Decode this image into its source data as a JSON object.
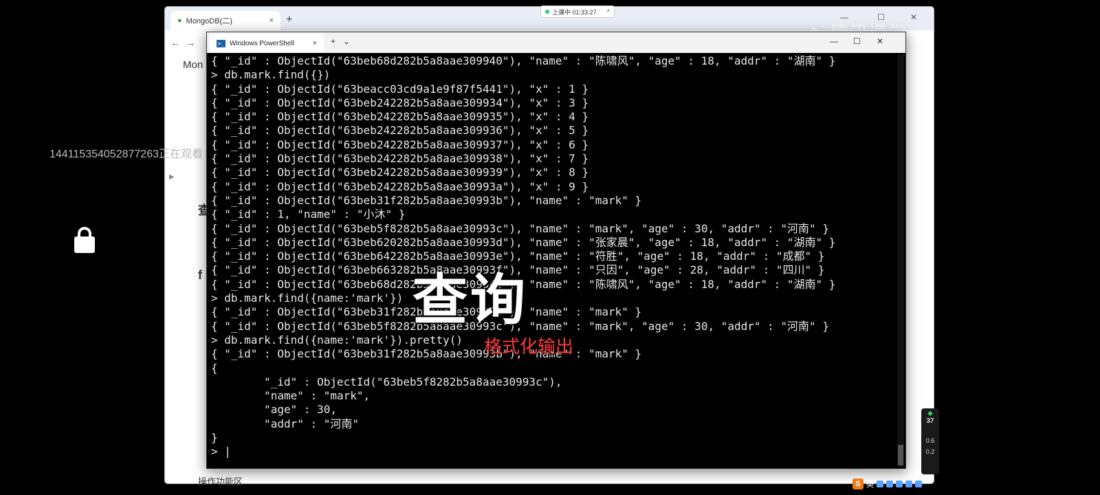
{
  "browser": {
    "tab_title": "MongoDB(二)",
    "tab_close": "×",
    "new_tab": "+",
    "nav_back": "←",
    "nav_forward": "→",
    "win_min": "—",
    "win_max": "☐",
    "win_close": "✕",
    "page_side_texts": [
      "Mon",
      "查",
      "f"
    ],
    "bottom_text": "操作功能区"
  },
  "status_pill": {
    "label": "上课中 01:33:27",
    "caret": "^"
  },
  "watermark": "腾讯课堂",
  "viewer_notice": "144115354052877263正在观看",
  "powershell": {
    "tab_title": "Windows PowerShell",
    "tab_close": "×",
    "new_tab": "+",
    "dropdown": "⌄",
    "win_min": "—",
    "win_max": "☐",
    "win_close": "✕"
  },
  "console_lines": [
    "{ \"_id\" : ObjectId(\"63beb68d282b5a8aae309940\"), \"name\" : \"陈啸风\", \"age\" : 18, \"addr\" : \"湖南\" }",
    "> db.mark.find({})",
    "{ \"_id\" : ObjectId(\"63beacc03cd9a1e9f87f5441\"), \"x\" : 1 }",
    "{ \"_id\" : ObjectId(\"63beb242282b5a8aae309934\"), \"x\" : 3 }",
    "{ \"_id\" : ObjectId(\"63beb242282b5a8aae309935\"), \"x\" : 4 }",
    "{ \"_id\" : ObjectId(\"63beb242282b5a8aae309936\"), \"x\" : 5 }",
    "{ \"_id\" : ObjectId(\"63beb242282b5a8aae309937\"), \"x\" : 6 }",
    "{ \"_id\" : ObjectId(\"63beb242282b5a8aae309938\"), \"x\" : 7 }",
    "{ \"_id\" : ObjectId(\"63beb242282b5a8aae309939\"), \"x\" : 8 }",
    "{ \"_id\" : ObjectId(\"63beb242282b5a8aae30993a\"), \"x\" : 9 }",
    "{ \"_id\" : ObjectId(\"63beb31f282b5a8aae30993b\"), \"name\" : \"mark\" }",
    "{ \"_id\" : 1, \"name\" : \"小沐\" }",
    "{ \"_id\" : ObjectId(\"63beb5f8282b5a8aae30993c\"), \"name\" : \"mark\", \"age\" : 30, \"addr\" : \"河南\" }",
    "{ \"_id\" : ObjectId(\"63beb620282b5a8aae30993d\"), \"name\" : \"张家晨\", \"age\" : 18, \"addr\" : \"湖南\" }",
    "{ \"_id\" : ObjectId(\"63beb642282b5a8aae30993e\"), \"name\" : \"符胜\", \"age\" : 18, \"addr\" : \"成都\" }",
    "{ \"_id\" : ObjectId(\"63beb663282b5a8aae30993f\"), \"name\" : \"只因\", \"age\" : 28, \"addr\" : \"四川\" }",
    "{ \"_id\" : ObjectId(\"63beb68d282b5a8aae309940\"), \"name\" : \"陈啸风\", \"age\" : 18, \"addr\" : \"湖南\" }",
    "> db.mark.find({name:'mark'})",
    "{ \"_id\" : ObjectId(\"63beb31f282b5a8aae30993b\"), \"name\" : \"mark\" }",
    "{ \"_id\" : ObjectId(\"63beb5f8282b5a8aae30993c\"), \"name\" : \"mark\", \"age\" : 30, \"addr\" : \"河南\" }",
    "> db.mark.find({name:'mark'}).pretty()",
    "{ \"_id\" : ObjectId(\"63beb31f282b5a8aae30993b\"), \"name\" : \"mark\" }",
    "{",
    "        \"_id\" : ObjectId(\"63beb5f8282b5a8aae30993c\"),",
    "        \"name\" : \"mark\",",
    "        \"age\" : 30,",
    "        \"addr\" : \"河南\"",
    "}",
    "> |"
  ],
  "overlays": {
    "big_caption": "查询",
    "red_caption": "格式化输出"
  },
  "right_widget": {
    "percent": "37",
    "stat1": "0.6",
    "stat2": "0.2"
  },
  "taskbar": {
    "ime_label": "英",
    "sogou_label": "S"
  },
  "colors": {
    "console_bg": "#000000",
    "console_fg": "#e8e8e8",
    "red_caption": "#ff3b3b"
  }
}
